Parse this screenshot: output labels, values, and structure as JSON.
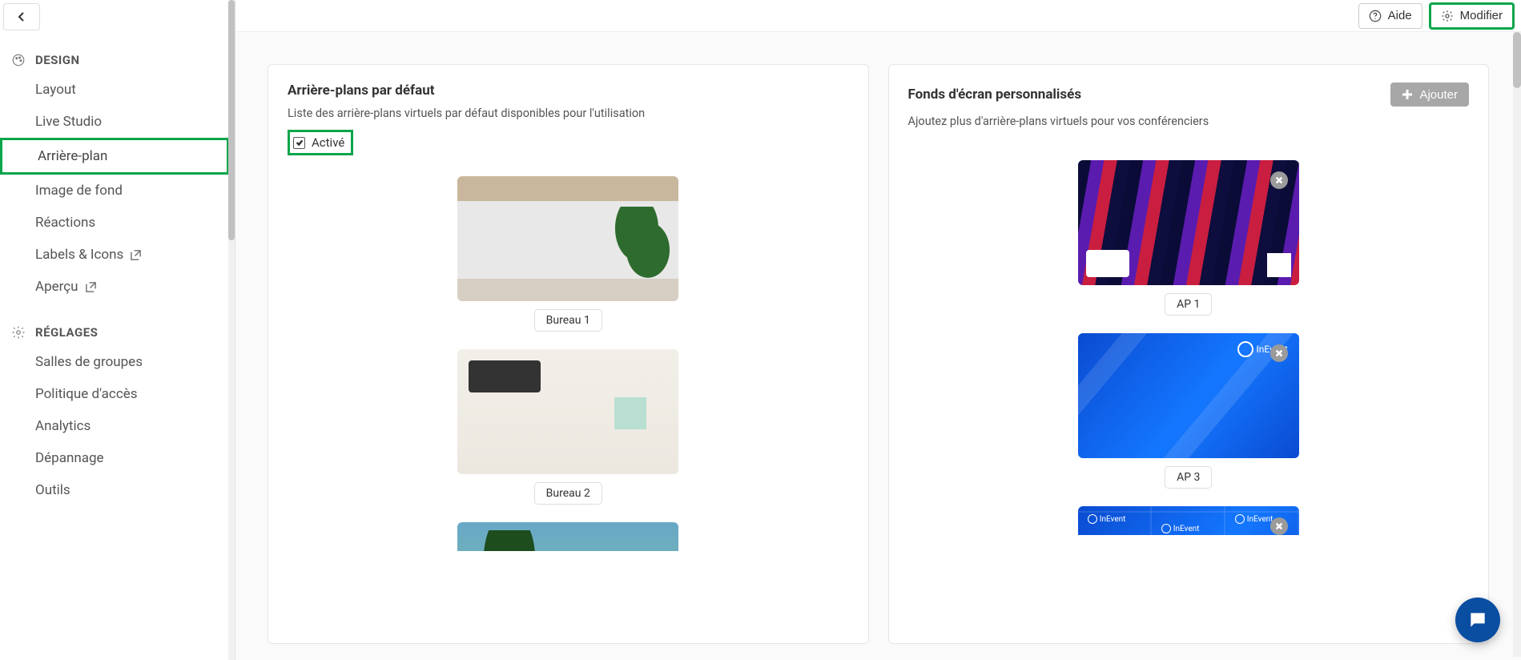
{
  "sidebar": {
    "sections": [
      {
        "title": "DESIGN",
        "items": [
          {
            "label": "Layout",
            "active": false,
            "external": false
          },
          {
            "label": "Live Studio",
            "active": false,
            "external": false
          },
          {
            "label": "Arrière-plan",
            "active": true,
            "external": false
          },
          {
            "label": "Image de fond",
            "active": false,
            "external": false
          },
          {
            "label": "Réactions",
            "active": false,
            "external": false
          },
          {
            "label": "Labels & Icons",
            "active": false,
            "external": true
          },
          {
            "label": "Aperçu",
            "active": false,
            "external": true
          }
        ]
      },
      {
        "title": "RÉGLAGES",
        "items": [
          {
            "label": "Salles de groupes",
            "active": false,
            "external": false
          },
          {
            "label": "Politique d'accès",
            "active": false,
            "external": false
          },
          {
            "label": "Analytics",
            "active": false,
            "external": false
          },
          {
            "label": "Dépannage",
            "active": false,
            "external": false
          },
          {
            "label": "Outils",
            "active": false,
            "external": false
          }
        ]
      }
    ]
  },
  "topbar": {
    "help_label": "Aide",
    "modify_label": "Modifier"
  },
  "default_panel": {
    "title": "Arrière-plans par défaut",
    "description": "Liste des arrière-plans virtuels par défaut disponibles pour l'utilisation",
    "enabled_label": "Activé",
    "enabled_checked": true,
    "items": [
      {
        "label": "Bureau 1"
      },
      {
        "label": "Bureau 2"
      },
      {
        "label": ""
      }
    ]
  },
  "custom_panel": {
    "title": "Fonds d'écran personnalisés",
    "description": "Ajoutez plus d'arrière-plans virtuels pour vos conférenciers",
    "add_label": "Ajouter",
    "inevent_label": "InEvent",
    "items": [
      {
        "label": "AP 1"
      },
      {
        "label": "AP 3"
      },
      {
        "label": ""
      }
    ]
  }
}
